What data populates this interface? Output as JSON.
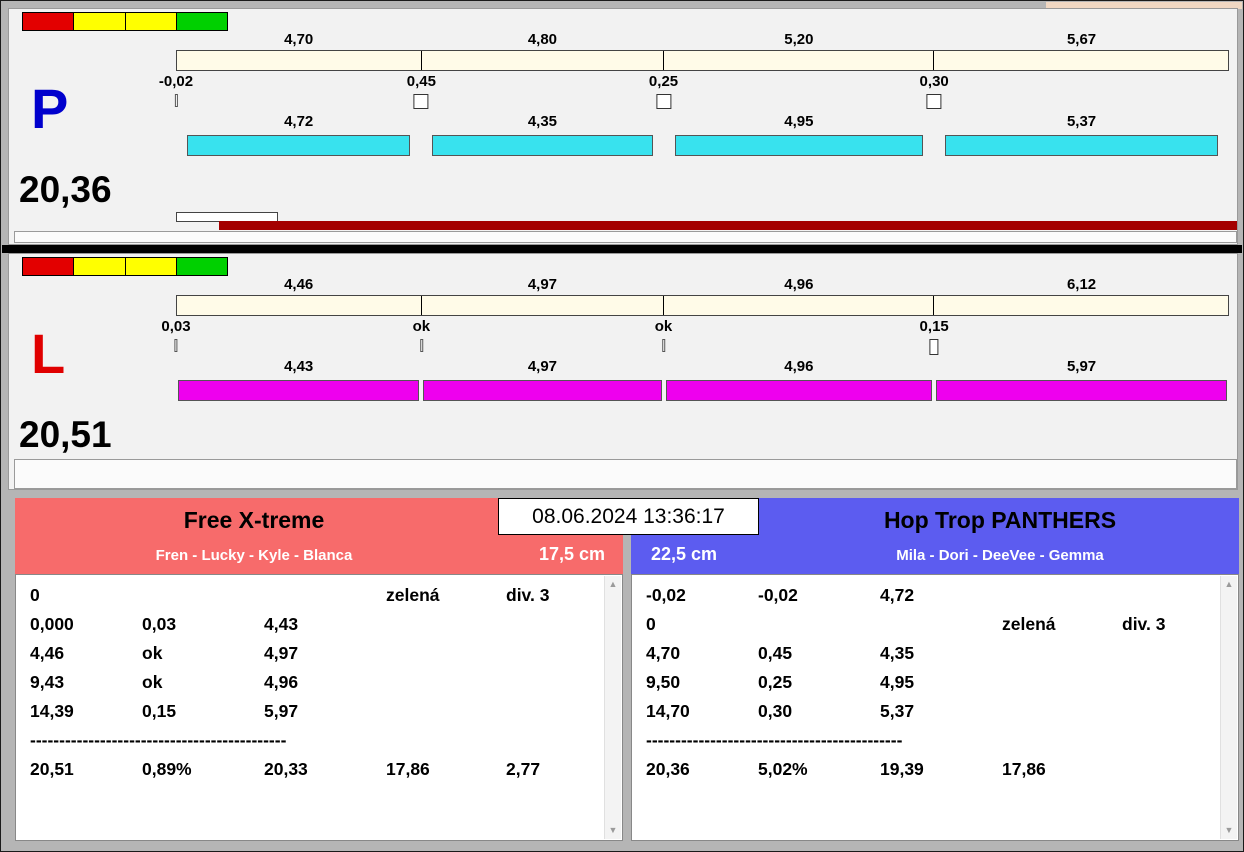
{
  "colors": {
    "cream_bar": "#fffbe8",
    "p_bar": "#38e2ee",
    "l_bar": "#ee00ee",
    "p_letter": "#0000cd",
    "l_letter": "#e00000",
    "run_bar": "#a40000",
    "left_header": "#f76b6b",
    "right_header": "#5c5cf0",
    "indicator": [
      "#e30000",
      "#ffff00",
      "#ffff00",
      "#00d000"
    ]
  },
  "icons": {
    "scroll_up": "▲",
    "scroll_down": "▼"
  },
  "lanes": {
    "p": {
      "letter": "P",
      "total": "20,36",
      "top_values": [
        "4,70",
        "4,80",
        "5,20",
        "5,67"
      ],
      "deltas": [
        {
          "value": "-0,02",
          "marker": "tick"
        },
        {
          "value": "0,45",
          "marker": "box"
        },
        {
          "value": "0,25",
          "marker": "box"
        },
        {
          "value": "0,30",
          "marker": "box"
        }
      ],
      "bottom_values": [
        "4,72",
        "4,35",
        "4,95",
        "5,37"
      ]
    },
    "l": {
      "letter": "L",
      "total": "20,51",
      "top_values": [
        "4,46",
        "4,97",
        "4,96",
        "6,12"
      ],
      "deltas": [
        {
          "value": "0,03",
          "marker": "tick"
        },
        {
          "value": "ok",
          "marker": "tick"
        },
        {
          "value": "ok",
          "marker": "tick"
        },
        {
          "value": "0,15",
          "marker": "narrow-box"
        }
      ],
      "bottom_values": [
        "4,43",
        "4,97",
        "4,96",
        "5,97"
      ]
    }
  },
  "datetime": "08.06.2024 13:36:17",
  "teams": {
    "left": {
      "name": "Free X-treme",
      "members": "Fren - Lucky - Kyle - Blanca",
      "jump_height": "17,5 cm",
      "rows": [
        [
          "0",
          "",
          "",
          "zelená",
          "div. 3"
        ],
        [
          "0,000",
          "0,03",
          "4,43",
          "",
          ""
        ],
        [
          "4,46",
          "ok",
          "4,97",
          "",
          ""
        ],
        [
          "9,43",
          "ok",
          "4,96",
          "",
          ""
        ],
        [
          "14,39",
          "0,15",
          "5,97",
          "",
          ""
        ]
      ],
      "separator": "--------------------------------------------",
      "summary": [
        "20,51",
        "0,89%",
        "20,33",
        "17,86",
        "2,77"
      ]
    },
    "right": {
      "name": "Hop Trop PANTHERS",
      "members": "Mila - Dori - DeeVee - Gemma",
      "jump_height": "22,5 cm",
      "rows": [
        [
          "-0,02",
          "-0,02",
          "4,72",
          "",
          ""
        ],
        [
          "0",
          "",
          "",
          "zelená",
          "div. 3"
        ],
        [
          "4,70",
          "0,45",
          "4,35",
          "",
          ""
        ],
        [
          "9,50",
          "0,25",
          "4,95",
          "",
          ""
        ],
        [
          "14,70",
          "0,30",
          "5,37",
          "",
          ""
        ]
      ],
      "separator": "--------------------------------------------",
      "summary": [
        "20,36",
        "5,02%",
        "19,39",
        "17,86",
        ""
      ]
    }
  }
}
